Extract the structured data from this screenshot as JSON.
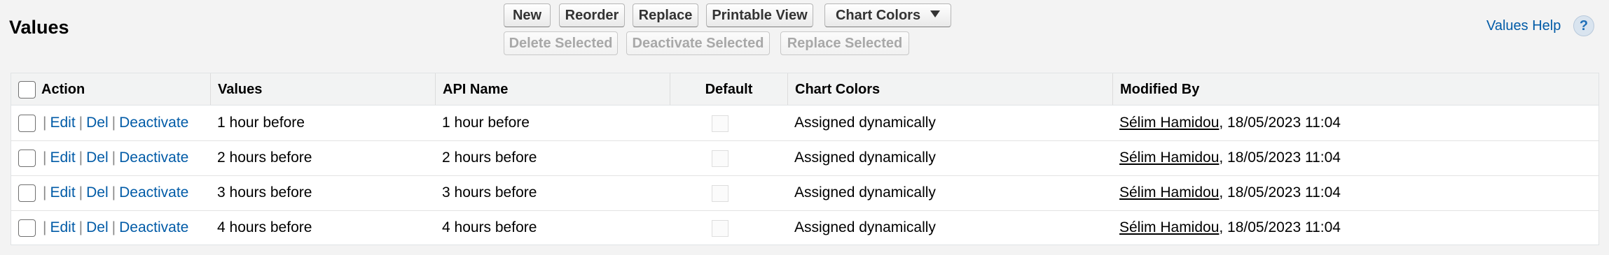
{
  "header": {
    "title": "Values",
    "help_label": "Values Help",
    "help_glyph": "?"
  },
  "toolbar": {
    "new": "New",
    "reorder": "Reorder",
    "replace": "Replace",
    "printable_view": "Printable View",
    "chart_colors": "Chart Colors",
    "delete_selected": "Delete Selected",
    "deactivate_selected": "Deactivate Selected",
    "replace_selected": "Replace Selected"
  },
  "table": {
    "columns": {
      "action": "Action",
      "values": "Values",
      "api_name": "API Name",
      "default": "Default",
      "chart_colors": "Chart Colors",
      "modified_by": "Modified By"
    },
    "action_labels": {
      "edit": "Edit",
      "del": "Del",
      "deactivate": "Deactivate",
      "separator": "|"
    },
    "rows": [
      {
        "value": "1 hour before",
        "api_name": "1 hour before",
        "default": false,
        "chart_colors": "Assigned dynamically",
        "modified_by_user": "Sélim Hamidou",
        "modified_by_date": ", 18/05/2023 11:04"
      },
      {
        "value": "2 hours before",
        "api_name": "2 hours before",
        "default": false,
        "chart_colors": "Assigned dynamically",
        "modified_by_user": "Sélim Hamidou",
        "modified_by_date": ", 18/05/2023 11:04"
      },
      {
        "value": "3 hours before",
        "api_name": "3 hours before",
        "default": false,
        "chart_colors": "Assigned dynamically",
        "modified_by_user": "Sélim Hamidou",
        "modified_by_date": ", 18/05/2023 11:04"
      },
      {
        "value": "4 hours before",
        "api_name": "4 hours before",
        "default": false,
        "chart_colors": "Assigned dynamically",
        "modified_by_user": "Sélim Hamidou",
        "modified_by_date": ", 18/05/2023 11:04"
      }
    ]
  },
  "colors": {
    "link": "#015ba7",
    "background": "#f3f3f3",
    "header_row": "#f2f3f3"
  },
  "icons": {
    "help": "help-circle-icon",
    "dropdown": "caret-down-icon"
  }
}
